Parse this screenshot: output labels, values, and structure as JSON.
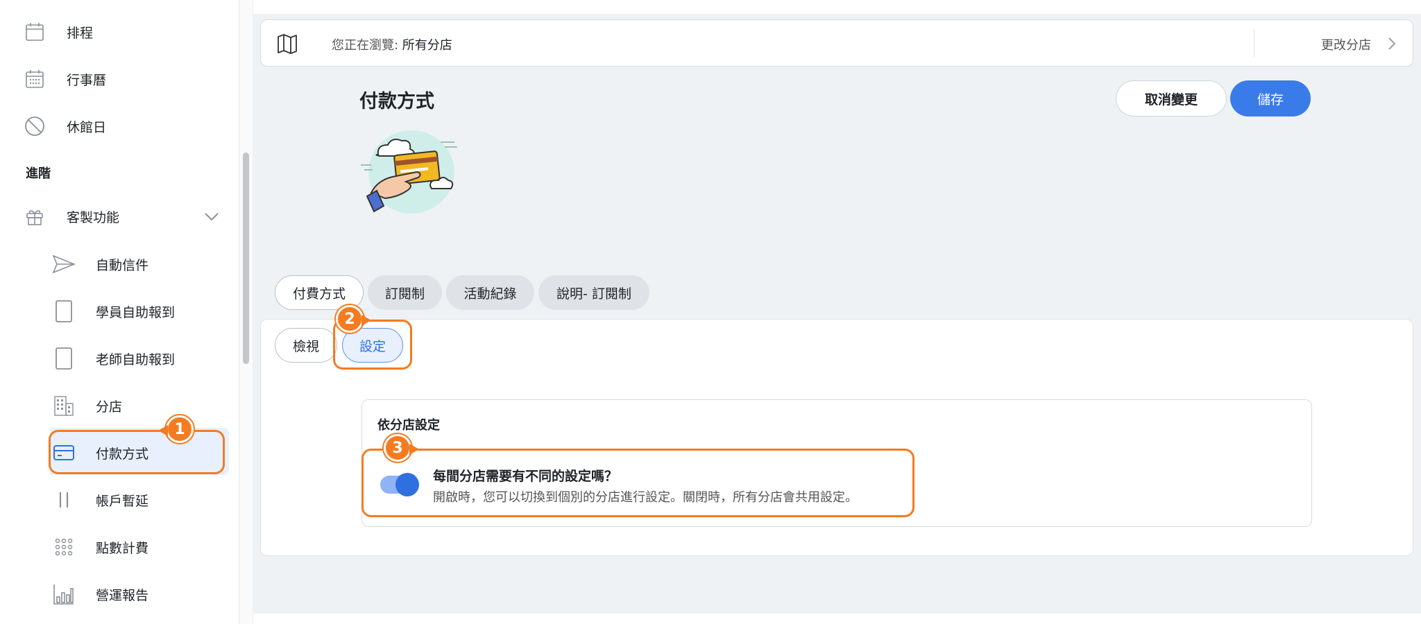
{
  "sidebar": {
    "items": [
      {
        "label": "排程",
        "icon": "calendar-blank-icon"
      },
      {
        "label": "行事曆",
        "icon": "calendar-grid-icon"
      },
      {
        "label": "休館日",
        "icon": "no-entry-icon"
      }
    ],
    "section_label": "進階",
    "group": {
      "label": "客製功能",
      "icon": "gift-icon",
      "expanded": true
    },
    "sub_items": [
      {
        "label": "自動信件",
        "icon": "send-icon"
      },
      {
        "label": "學員自助報到",
        "icon": "tablet-icon"
      },
      {
        "label": "老師自助報到",
        "icon": "tablet-icon"
      },
      {
        "label": "分店",
        "icon": "building-icon"
      },
      {
        "label": "付款方式",
        "icon": "credit-card-icon",
        "active": true
      },
      {
        "label": "帳戶暫延",
        "icon": "pause-icon"
      },
      {
        "label": "點數計費",
        "icon": "dots-grid-icon"
      },
      {
        "label": "營運報告",
        "icon": "bar-chart-icon"
      }
    ]
  },
  "topbar": {
    "browse_prefix": "您正在瀏覽: ",
    "browse_value": "所有分店",
    "change_label": "更改分店"
  },
  "page": {
    "title": "付款方式",
    "cancel_label": "取消變更",
    "save_label": "儲存"
  },
  "tabs": [
    {
      "label": "付費方式",
      "active": true
    },
    {
      "label": "訂閱制",
      "active": false
    },
    {
      "label": "活動紀錄",
      "active": false
    },
    {
      "label": "說明- 訂閱制",
      "active": false
    }
  ],
  "sub_tabs": [
    {
      "label": "檢視",
      "active": false
    },
    {
      "label": "設定",
      "active": true
    }
  ],
  "settings": {
    "card_title": "依分店設定",
    "question": "每間分店需要有不同的設定嗎？",
    "description": "開啟時，您可以切換到個別的分店進行設定。關閉時，所有分店會共用設定。",
    "toggle_on": true
  },
  "callouts": [
    "1",
    "2",
    "3"
  ],
  "colors": {
    "accent": "#3a7bea",
    "callout": "#f47b20"
  }
}
